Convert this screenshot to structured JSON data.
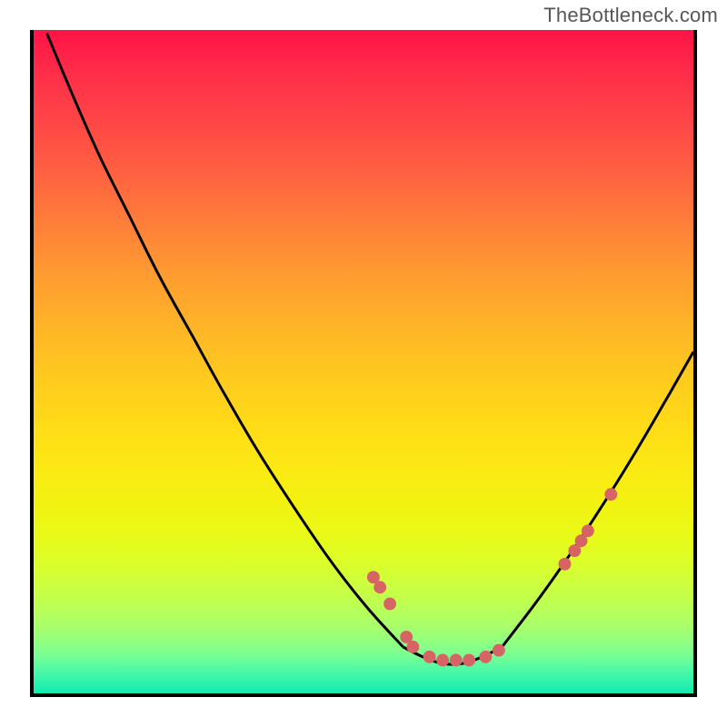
{
  "watermark": "TheBottleneck.com",
  "colors": {
    "border": "#000000",
    "curve": "#000000",
    "dot": "#d66464",
    "gradient_top": "#ff1345",
    "gradient_bottom": "#11eab2"
  },
  "chart_data": {
    "type": "line",
    "title": "",
    "xlabel": "",
    "ylabel": "",
    "xlim": [
      0,
      100
    ],
    "ylim": [
      0,
      100
    ],
    "grid": false,
    "note": "Y is inverted visually (0 at top, 100 at bottom of plot). Values estimated from pixel positions; chart has no axis ticks.",
    "series": [
      {
        "name": "left-curve",
        "x": [
          2.0,
          6.0,
          10.0,
          14.5,
          19.0,
          24.0,
          29.0,
          34.0,
          39.5,
          45.0,
          50.5,
          56.0
        ],
        "y": [
          0.5,
          10.0,
          19.0,
          28.0,
          37.0,
          46.0,
          55.0,
          63.5,
          72.0,
          80.0,
          87.0,
          93.0
        ]
      },
      {
        "name": "valley-floor",
        "x": [
          56.0,
          59.0,
          62.0,
          65.0,
          68.0,
          71.0
        ],
        "y": [
          93.0,
          94.5,
          95.5,
          95.5,
          94.5,
          93.0
        ]
      },
      {
        "name": "right-curve",
        "x": [
          71.0,
          76.0,
          81.0,
          86.0,
          91.0,
          96.0,
          100.0
        ],
        "y": [
          93.0,
          86.5,
          79.5,
          72.0,
          64.0,
          55.5,
          48.5
        ]
      }
    ],
    "annotations": {
      "name": "scatter-dots",
      "type": "scatter",
      "x": [
        51.5,
        52.5,
        54.0,
        56.5,
        57.5,
        60.0,
        62.0,
        64.0,
        66.0,
        68.5,
        70.5,
        80.5,
        82.0,
        83.0,
        84.0,
        87.5
      ],
      "y": [
        82.5,
        84.0,
        86.5,
        91.5,
        93.0,
        94.5,
        95.0,
        95.0,
        95.0,
        94.5,
        93.5,
        80.5,
        78.5,
        77.0,
        75.5,
        70.0
      ]
    }
  }
}
